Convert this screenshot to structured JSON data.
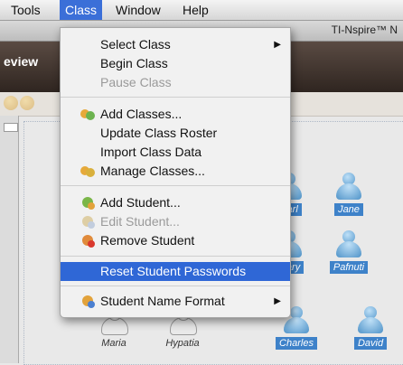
{
  "menubar": {
    "items": [
      {
        "label": "Tools"
      },
      {
        "label": "Class"
      },
      {
        "label": "Window"
      },
      {
        "label": "Help"
      }
    ]
  },
  "app": {
    "title": "TI-Nspire™ N"
  },
  "header": {
    "preview_label": "eview"
  },
  "class_menu": {
    "items": [
      {
        "label": "Select Class",
        "disabled": false
      },
      {
        "label": "Begin Class",
        "disabled": false
      },
      {
        "label": "Pause Class",
        "disabled": true
      },
      {
        "label": "Add Classes...",
        "disabled": false
      },
      {
        "label": "Update Class Roster",
        "disabled": false
      },
      {
        "label": "Import Class Data",
        "disabled": false
      },
      {
        "label": "Manage Classes...",
        "disabled": false
      },
      {
        "label": "Add Student...",
        "disabled": false
      },
      {
        "label": "Edit Student...",
        "disabled": true
      },
      {
        "label": "Remove Student",
        "disabled": false
      },
      {
        "label": "Reset Student Passwords",
        "disabled": false,
        "highlighted": true
      },
      {
        "label": "Student Name Format",
        "disabled": false
      }
    ],
    "submenu_arrow": "▶",
    "highlight_color": "#2f67d6"
  },
  "students": [
    {
      "name": "Karl"
    },
    {
      "name": "Jane"
    },
    {
      "name": "Mary"
    },
    {
      "name": "Pafnuti"
    },
    {
      "name": "Maria"
    },
    {
      "name": "Hypatia"
    },
    {
      "name": "Charles"
    },
    {
      "name": "David"
    }
  ],
  "colors": {
    "selection": "#3e82c9",
    "header_dark": "#2f2520"
  }
}
